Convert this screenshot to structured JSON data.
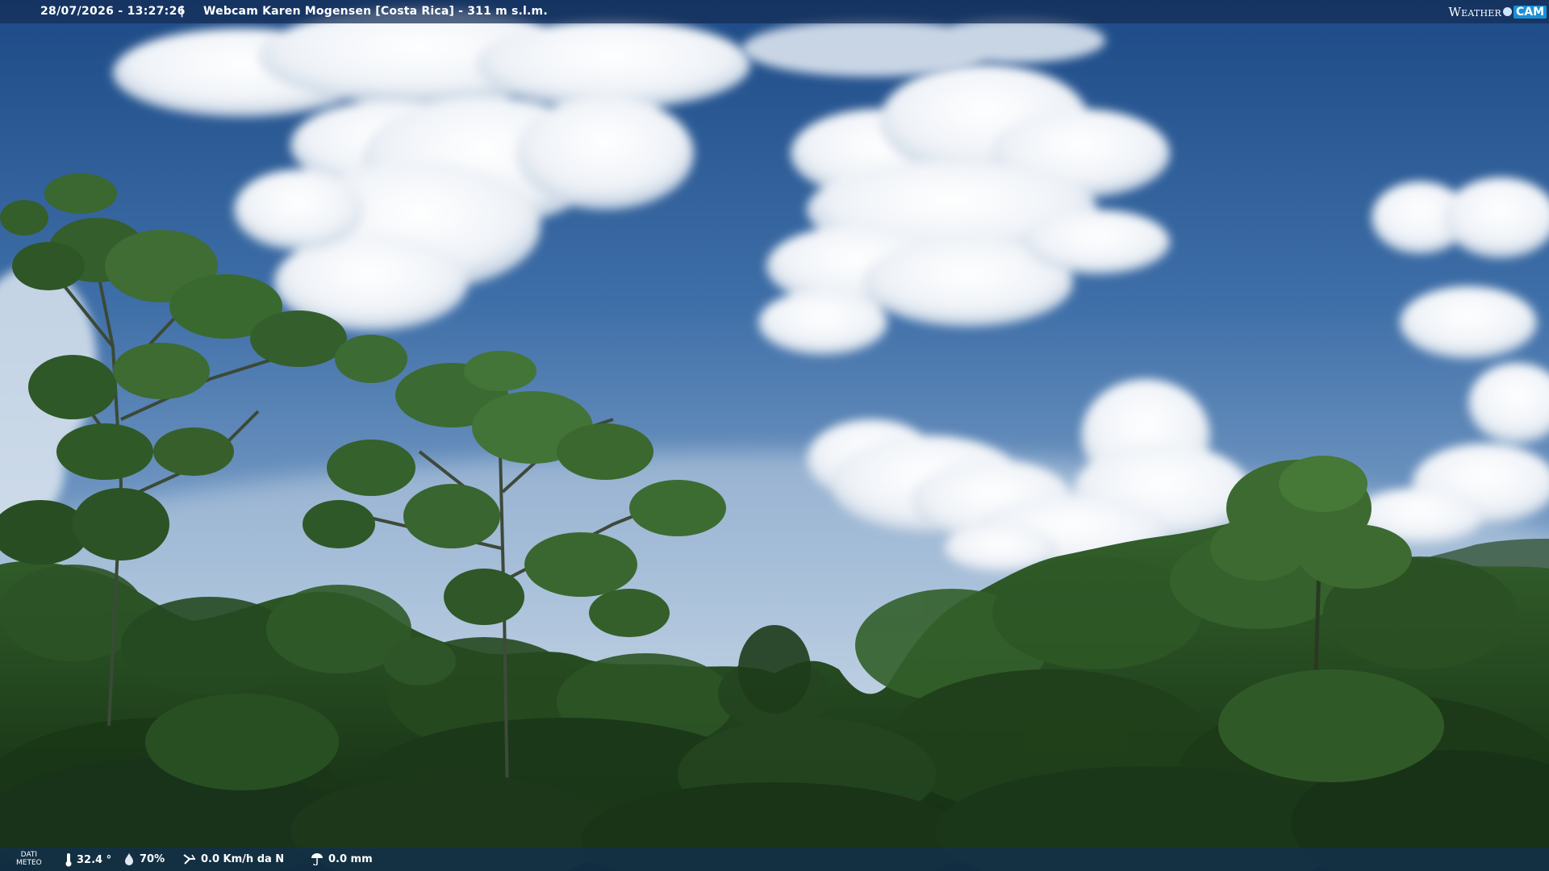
{
  "overlay_top": {
    "datetime": "28/07/2026 - 13:27:26",
    "separator": "|",
    "caption": "Webcam Karen Mogensen [Costa Rica] - 311 m s.l.m."
  },
  "logo": {
    "weather": "Weather",
    "cam": "CAM"
  },
  "overlay_bottom": {
    "label_line1": "DATI",
    "label_line2": "METEO",
    "temperature": "32.4 °",
    "humidity": "70%",
    "wind": "0.0 Km/h da N",
    "rain": "0.0 mm",
    "temperature_icon": "thermometer-icon",
    "humidity_icon": "humidity-drop-icon",
    "wind_icon": "wind-vane-icon",
    "rain_icon": "rain-gauge-icon"
  },
  "colors": {
    "sky_top": "#1f4f8e",
    "sky_horizon": "#a9c3df",
    "cloud": "#f2f5f9",
    "forest_dark": "#17361a",
    "forest_mid": "#2f5a26",
    "foliage_light": "#5d8a47",
    "logo_accent": "#1b8fd6"
  }
}
